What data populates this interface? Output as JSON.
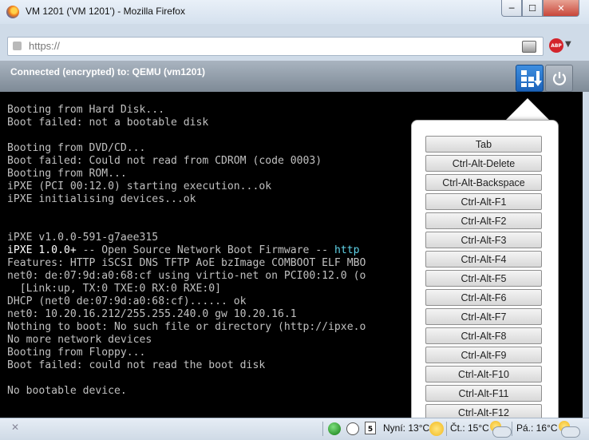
{
  "window": {
    "title": "VM 1201 ('VM 1201') - Mozilla Firefox",
    "controls": {
      "minimize": "─",
      "maximize": "☐",
      "close": "✕"
    }
  },
  "address_bar": {
    "url": "https://",
    "icons": [
      "site-identity-icon",
      "page-icon",
      "adblock-plus-icon",
      "menu-arrow-icon"
    ],
    "abp_label": "ABP",
    "menu_arrow": "▼"
  },
  "vnc_bar": {
    "status": "Connected (encrypted) to: QEMU (vm1201)",
    "keys_button_icon": "send-keys-icon",
    "power_button_icon": "power-icon"
  },
  "console": {
    "lines": [
      "Booting from Hard Disk...",
      "Boot failed: not a bootable disk",
      "",
      "Booting from DVD/CD...",
      "Boot failed: Could not read from CDROM (code 0003)",
      "Booting from ROM...",
      "iPXE (PCI 00:12.0) starting execution...ok",
      "iPXE initialising devices...ok",
      "",
      "",
      "iPXE v1.0.0-591-g7aee315",
      "iPXE 1.0.0+ -- Open Source Network Boot Firmware -- http",
      "Features: HTTP iSCSI DNS TFTP AoE bzImage COMBOOT ELF MBO",
      "net0: de:07:9d:a0:68:cf using virtio-net on PCI00:12.0 (o",
      "  [Link:up, TX:0 TXE:0 RX:0 RXE:0]",
      "DHCP (net0 de:07:9d:a0:68:cf)...... ok",
      "net0: 10.20.16.212/255.255.240.0 gw 10.20.16.1",
      "Nothing to boot: No such file or directory (http://ipxe.o",
      "No more network devices",
      "Booting from Floppy...",
      "Boot failed: could not read the boot disk",
      "",
      "No bootable device."
    ],
    "ipxe_line_prefix": "iPXE 1.0.0+",
    "ipxe_line_middle": " -- Open Source Network Boot Firmware -- ",
    "ipxe_line_link": "http"
  },
  "keys_popup": {
    "buttons": [
      "Tab",
      "Ctrl-Alt-Delete",
      "Ctrl-Alt-Backspace",
      "Ctrl-Alt-F1",
      "Ctrl-Alt-F2",
      "Ctrl-Alt-F3",
      "Ctrl-Alt-F4",
      "Ctrl-Alt-F5",
      "Ctrl-Alt-F6",
      "Ctrl-Alt-F7",
      "Ctrl-Alt-F8",
      "Ctrl-Alt-F9",
      "Ctrl-Alt-F10",
      "Ctrl-Alt-F11",
      "Ctrl-Alt-F12"
    ]
  },
  "addon_bar": {
    "close": "✕",
    "calendar_day": "5",
    "weather": [
      {
        "label": "Nyní: 13°C",
        "icon": "sun-icon"
      },
      {
        "label": "Čt.: 15°C",
        "icon": "partly-cloudy-icon"
      },
      {
        "label": "Pá.: 16°C",
        "icon": "partly-cloudy-icon"
      }
    ]
  }
}
